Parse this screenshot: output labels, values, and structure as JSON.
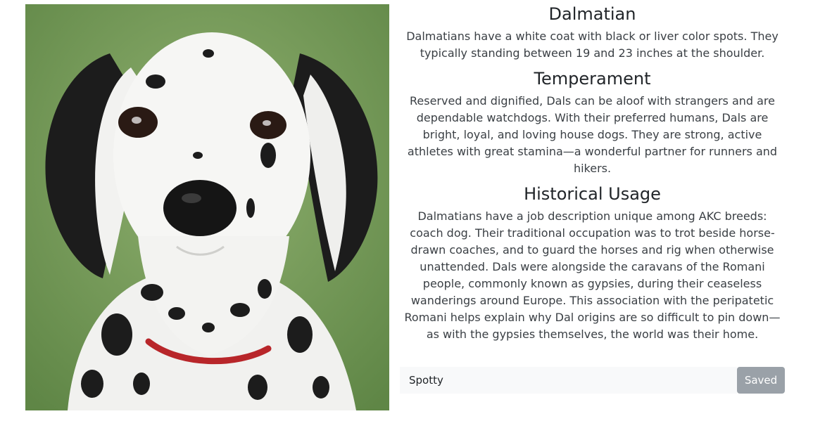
{
  "photo": {
    "subject": "dalmatian puppy",
    "colors": {
      "grass": "#7a9e5c",
      "coat": "#f4f4f2",
      "spot": "#1a1a1a",
      "collar": "#b8262a"
    }
  },
  "breed": {
    "title": "Dalmatian",
    "description": "Dalmatians have a white coat with black or liver color spots. They typically standing between 19 and 23 inches at the shoulder."
  },
  "temperament": {
    "title": "Temperament",
    "text": "Reserved and dignified, Dals can be aloof with strangers and are dependable watchdogs. With their preferred humans, Dals are bright, loyal, and loving house dogs. They are strong, active athletes with great stamina—a wonderful partner for runners and hikers."
  },
  "history": {
    "title": "Historical Usage",
    "text": "Dalmatians have a job description unique among AKC breeds: coach dog. Their traditional occupation was to trot beside horse-drawn coaches, and to guard the horses and rig when otherwise unattended. Dals were alongside the caravans of the Romani people, commonly known as gypsies, during their ceaseless wanderings around Europe. This association with the peripatetic Romani helps explain why Dal origins are so difficult to pin down—as with the gypsies themselves, the world was their home."
  },
  "name_form": {
    "value": "Spotty",
    "button_label": "Saved",
    "button_color": "#9aa1a8"
  }
}
